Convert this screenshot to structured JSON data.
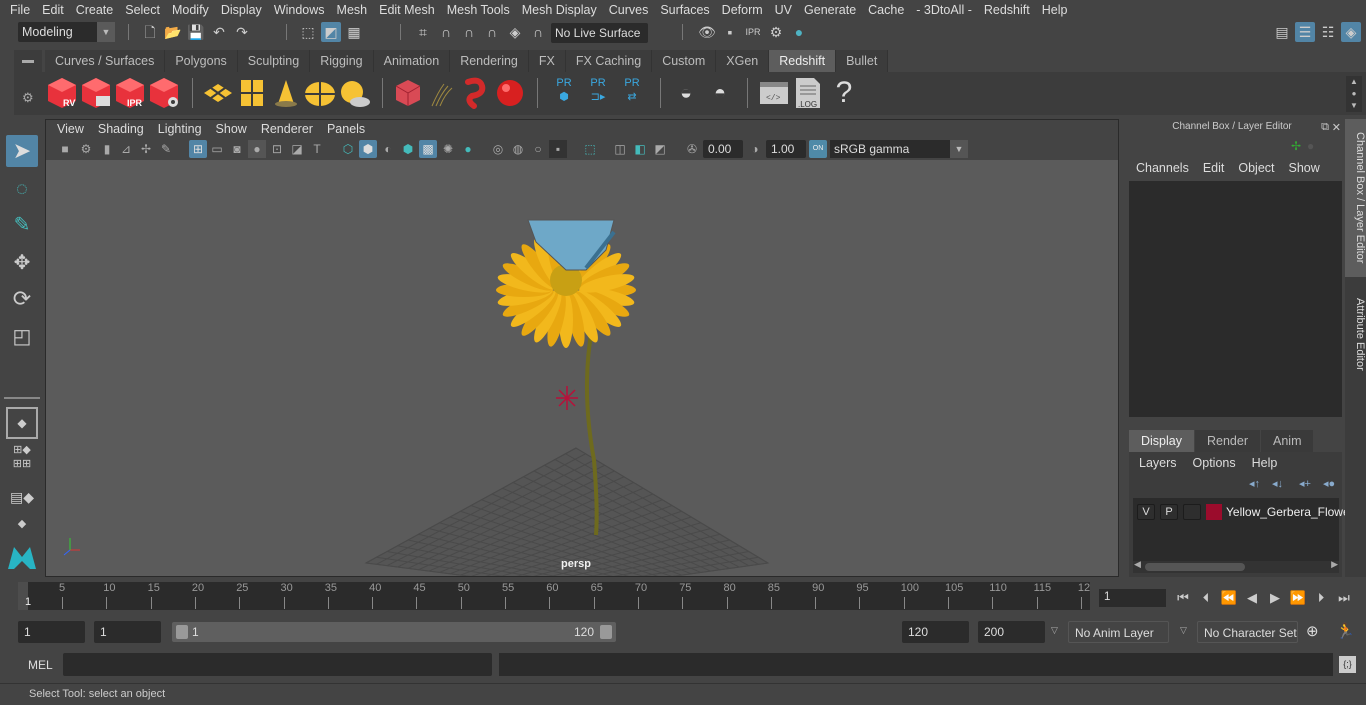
{
  "menubar": {
    "items": [
      "File",
      "Edit",
      "Create",
      "Select",
      "Modify",
      "Display",
      "Windows",
      "Mesh",
      "Edit Mesh",
      "Mesh Tools",
      "Mesh Display",
      "Curves",
      "Surfaces",
      "Deform",
      "UV",
      "Generate",
      "Cache",
      "- 3DtoAll -",
      "Redshift",
      "Help"
    ]
  },
  "statusline": {
    "mode": "Modeling",
    "live_surface": "No Live Surface"
  },
  "shelf": {
    "tabs": [
      "Curves / Surfaces",
      "Polygons",
      "Sculpting",
      "Rigging",
      "Animation",
      "Rendering",
      "FX",
      "FX Caching",
      "Custom",
      "XGen",
      "Redshift",
      "Bullet"
    ],
    "active_tab": "Redshift",
    "icons": [
      {
        "name": "redshift-render-view-icon",
        "label": "RV"
      },
      {
        "name": "redshift-batch-render-icon",
        "label": ""
      },
      {
        "name": "redshift-ipr-icon",
        "label": "IPR"
      },
      {
        "name": "redshift-render-settings-icon",
        "label": ""
      },
      {
        "name": "area-light-icon",
        "label": ""
      },
      {
        "name": "portal-light-icon",
        "label": ""
      },
      {
        "name": "spot-light-icon",
        "label": ""
      },
      {
        "name": "dome-light-icon",
        "label": ""
      },
      {
        "name": "sun-sky-icon",
        "label": ""
      },
      {
        "name": "volume-icon",
        "label": ""
      },
      {
        "name": "hair-icon",
        "label": ""
      },
      {
        "name": "mesh-light-icon",
        "label": ""
      },
      {
        "name": "sphere-light-icon",
        "label": ""
      },
      {
        "name": "proxy-create-icon",
        "label": "PR"
      },
      {
        "name": "proxy-export-icon",
        "label": "PR"
      },
      {
        "name": "proxy-swap-icon",
        "label": "PR"
      },
      {
        "name": "bake-multi-icon",
        "label": ""
      },
      {
        "name": "bake-icon",
        "label": ""
      },
      {
        "name": "script-editor-icon",
        "label": ""
      },
      {
        "name": "log-icon",
        "label": ".LOG"
      },
      {
        "name": "help-icon",
        "label": "?"
      }
    ]
  },
  "viewport": {
    "menu": [
      "View",
      "Shading",
      "Lighting",
      "Show",
      "Renderer",
      "Panels"
    ],
    "exposure": "0.00",
    "gamma": "1.00",
    "color_mgmt_toggle": "ON",
    "color_space": "sRGB gamma",
    "camera_label": "persp"
  },
  "channel_box": {
    "title": "Channel Box / Layer Editor",
    "menu": [
      "Channels",
      "Edit",
      "Object",
      "Show"
    ]
  },
  "layer_editor": {
    "tabs": [
      "Display",
      "Render",
      "Anim"
    ],
    "active_tab": "Display",
    "menu": [
      "Layers",
      "Options",
      "Help"
    ],
    "layers": [
      {
        "v": "V",
        "p": "P",
        "color": "#9b0c2c",
        "name": "Yellow_Gerbera_Flowe"
      }
    ]
  },
  "side_tabs": [
    "Channel Box / Layer Editor",
    "Attribute Editor"
  ],
  "timeline": {
    "ticks": [
      5,
      10,
      15,
      20,
      25,
      30,
      35,
      40,
      45,
      50,
      55,
      60,
      65,
      70,
      75,
      80,
      85,
      90,
      95,
      100,
      105,
      110,
      115,
      "12"
    ],
    "current_frame_marker": "1",
    "current_frame": "1"
  },
  "range": {
    "start": "1",
    "playback_start": "1",
    "slider_start": "1",
    "slider_end": "120",
    "playback_end": "120",
    "end": "200",
    "anim_layer": "No Anim Layer",
    "character_set": "No Character Set"
  },
  "command": {
    "language": "MEL"
  },
  "status": {
    "help_line": "Select Tool: select an object"
  }
}
